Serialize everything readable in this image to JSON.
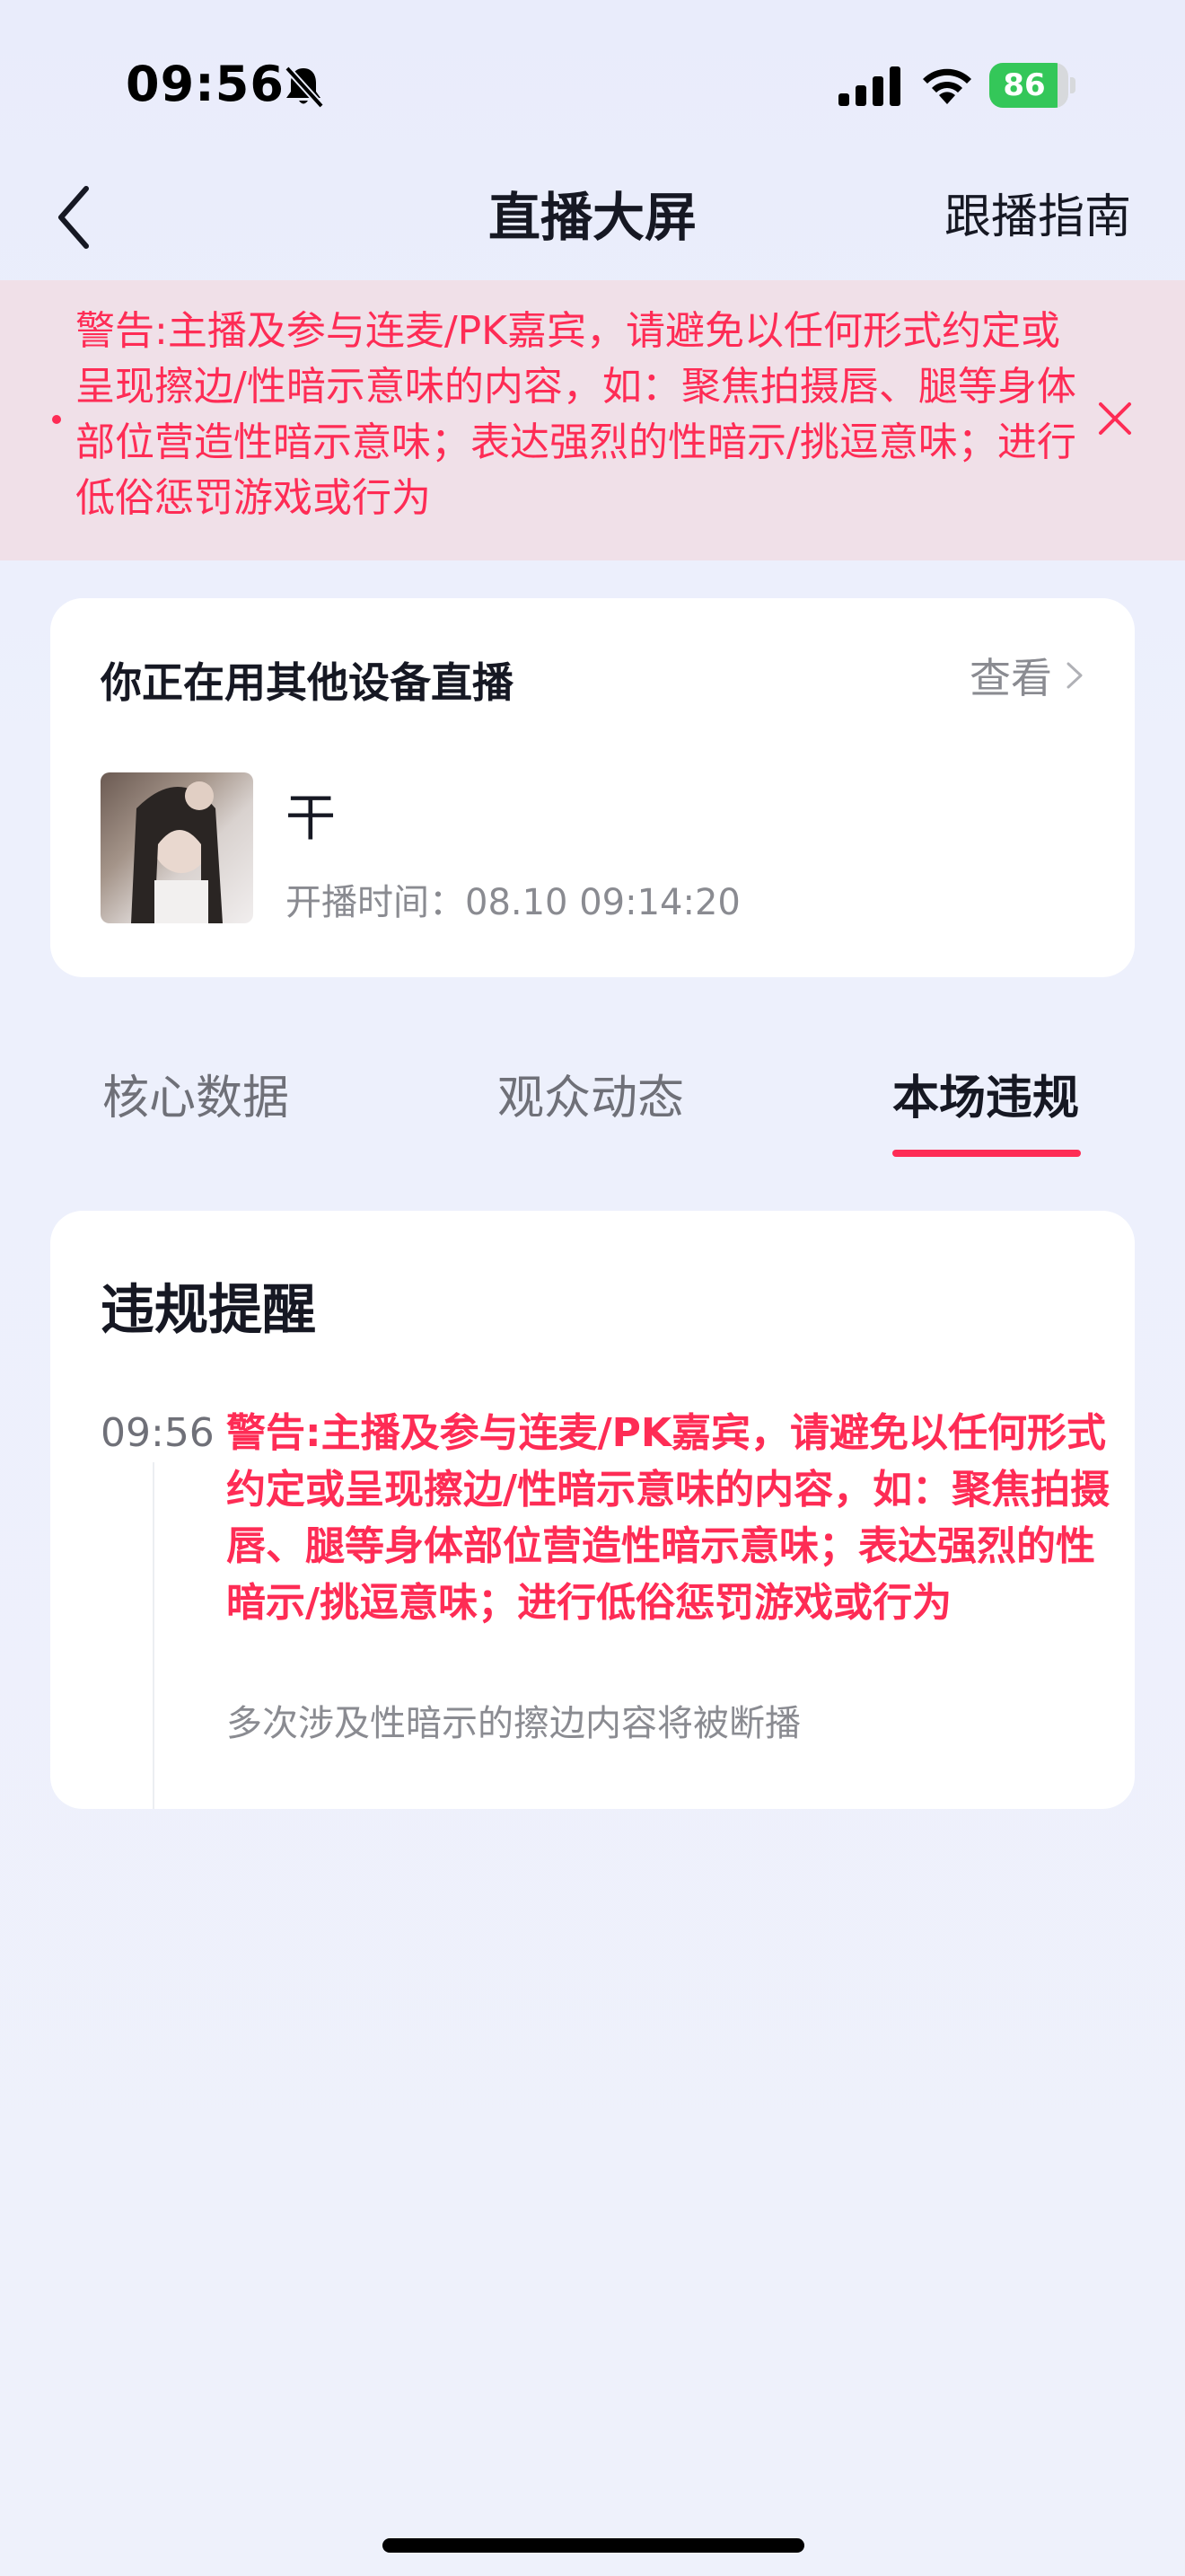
{
  "status_bar": {
    "time": "09:56",
    "battery_text": "86",
    "battery_level": 0.86,
    "silent_icon": "bell-slash-icon",
    "signal_icon": "cellular-signal-icon",
    "wifi_icon": "wifi-icon"
  },
  "nav": {
    "title": "直播大屏",
    "guide_label": "跟播指南",
    "back_icon": "chevron-left-icon"
  },
  "warning_banner": {
    "text": "警告:主播及参与连麦/PK嘉宾，请避免以任何形式约定或呈现擦边/性暗示意味的内容，如：聚焦拍摄唇、腿等身体部位营造性暗示意味；表达强烈的性暗示/挑逗意味；进行低俗惩罚游戏或行为",
    "close_icon": "close-icon"
  },
  "device_card": {
    "title": "你正在用其他设备直播",
    "view_label": "查看",
    "streamer_name": "干",
    "start_time": "开播时间：08.10 09:14:20"
  },
  "tabs": [
    {
      "label": "核心数据",
      "active": false
    },
    {
      "label": "观众动态",
      "active": false
    },
    {
      "label": "本场违规",
      "active": true
    }
  ],
  "violation_card": {
    "title": "违规提醒",
    "items": [
      {
        "time": "09:56",
        "text": "警告:主播及参与连麦/PK嘉宾，请避免以任何形式约定或呈现擦边/性暗示意味的内容，如：聚焦拍摄唇、腿等身体部位营造性暗示意味；表达强烈的性暗示/挑逗意味；进行低俗惩罚游戏或行为",
        "note": "多次涉及性暗示的擦边内容将被断播"
      }
    ]
  },
  "colors": {
    "accent": "#fe2c55",
    "banner_bg": "#f0e0e8",
    "battery_green": "#34c759"
  }
}
